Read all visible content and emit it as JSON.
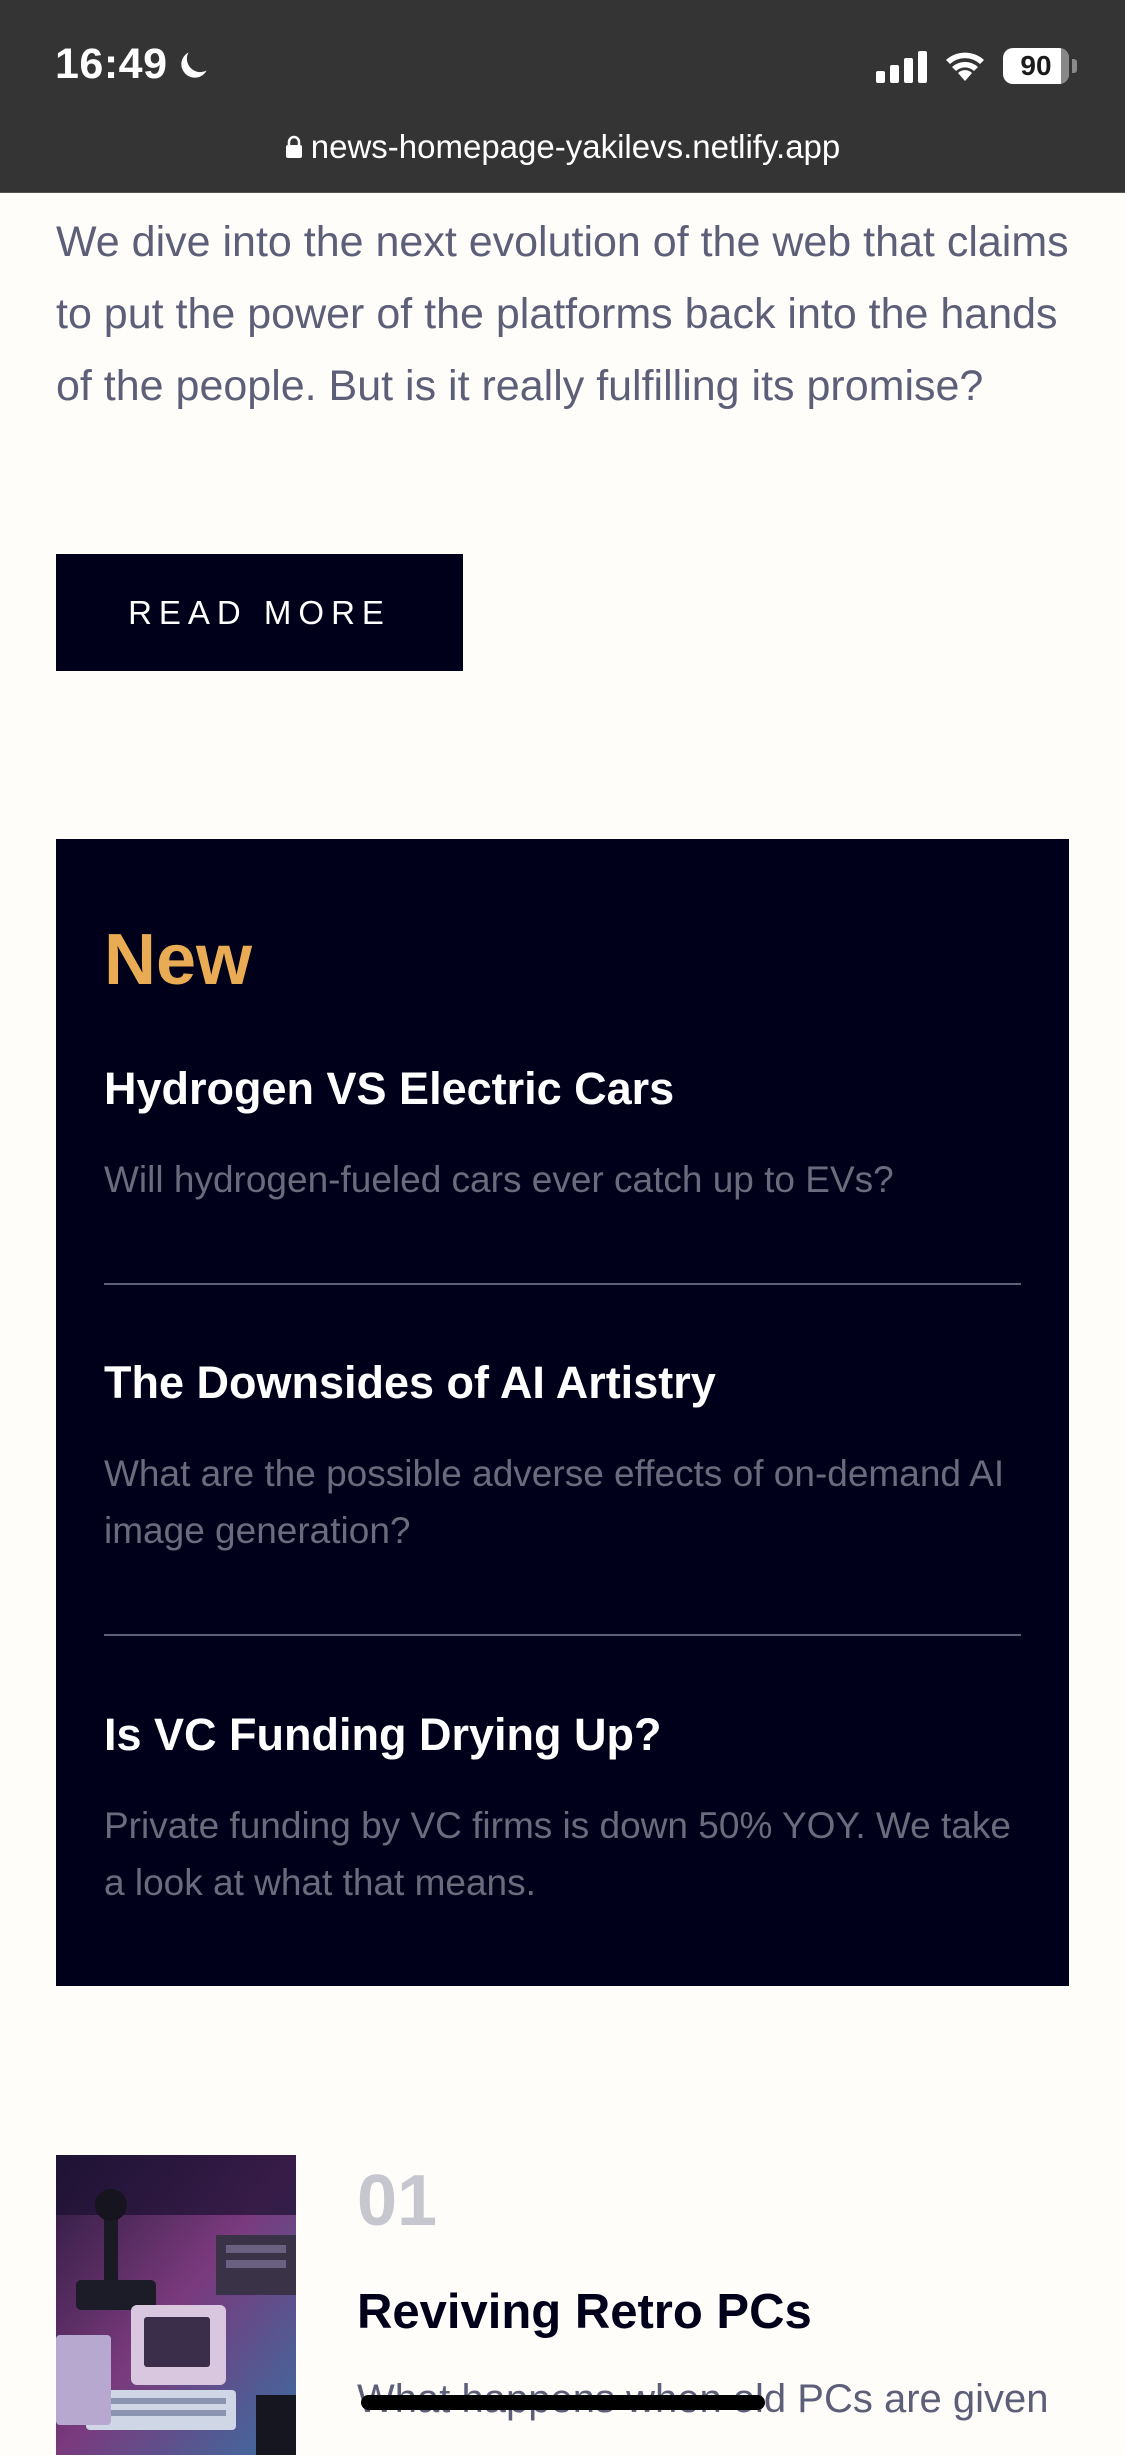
{
  "status_bar": {
    "time": "16:49",
    "battery": "90",
    "url": "news-homepage-yakilevs.netlify.app"
  },
  "article": {
    "excerpt": "We dive into the next evolution of the web that claims to put the power of the platforms back into the hands of the people. But is it really fulfilling its promise?",
    "read_more_label": "READ MORE"
  },
  "new_section": {
    "title": "New",
    "items": [
      {
        "title": "Hydrogen VS Electric Cars",
        "description": "Will hydrogen-fueled cars ever catch up to EVs?"
      },
      {
        "title": "The Downsides of AI Artistry",
        "description": "What are the possible adverse effects of on-demand AI image generation?"
      },
      {
        "title": "Is VC Funding Drying Up?",
        "description": "Private funding by VC firms is down 50% YOY. We take a look at what that means."
      }
    ]
  },
  "numbered_articles": [
    {
      "number": "01",
      "title": "Reviving Retro PCs",
      "description": "What happens when old PCs are given"
    }
  ],
  "colors": {
    "background": "#fffdfa",
    "dark_navy": "#00001a",
    "accent_orange": "#e9ab53",
    "body_text": "#5d5f79",
    "muted_text": "#6b6b7d",
    "status_bar": "#343434"
  },
  "icons": {
    "moon": "moon-icon",
    "signal": "signal-icon",
    "wifi": "wifi-icon",
    "battery": "battery-icon",
    "lock": "lock-icon"
  }
}
